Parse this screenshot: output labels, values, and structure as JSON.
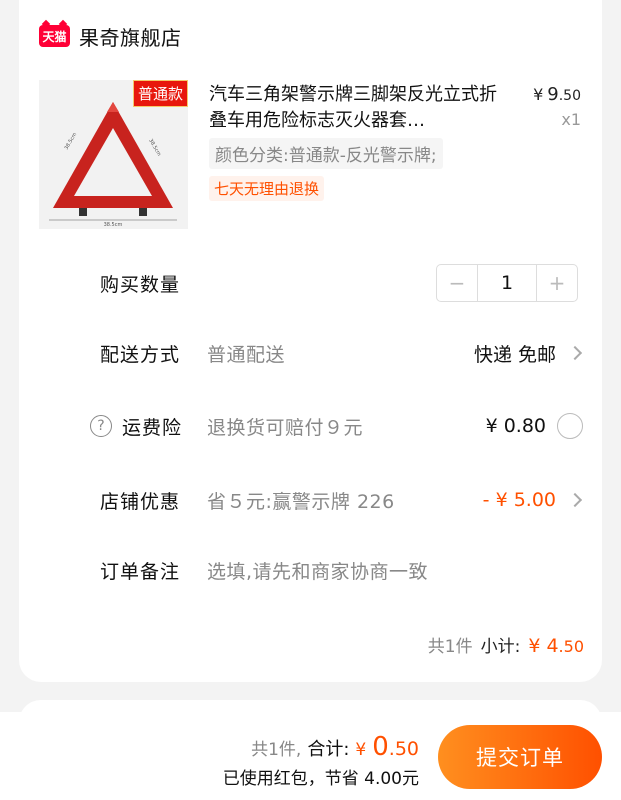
{
  "store": {
    "badge": "天猫",
    "name": "果奇旗舰店"
  },
  "product": {
    "image_tag": "普通款",
    "triangle_labels": [
      "38.5cm",
      "38.5cm",
      "38.5cm"
    ],
    "title": "汽车三角架警示牌三脚架反光立式折叠车用危险标志灭火器套…",
    "price_currency": "¥",
    "price_int": "9",
    "price_dec": ".50",
    "quantity_text": "x1",
    "variant": "颜色分类:普通款-反光警示牌;",
    "refund_tag": "七天无理由退换"
  },
  "quantity": {
    "label": "购买数量",
    "minus": "−",
    "value": "1",
    "plus": "+"
  },
  "delivery": {
    "label": "配送方式",
    "sub": "普通配送",
    "value": "快递 免邮"
  },
  "insurance": {
    "help": "?",
    "label": "运费险",
    "sub": "退换货可赔付９元",
    "value": "¥ 0.80"
  },
  "discount": {
    "label": "店铺优惠",
    "sub": "省５元:赢警示牌 226",
    "value": "- ¥ 5.00"
  },
  "note": {
    "label": "订单备注",
    "placeholder": "选填,请先和商家协商一致"
  },
  "subtotal": {
    "count": "共1件",
    "label": "小计:",
    "currency": "¥",
    "int": "4",
    "dec": ".50"
  },
  "footer": {
    "count": "共1件,",
    "total_label": "合计:",
    "currency": "¥",
    "int": "0",
    "dec": ".50",
    "saving": "已使用红包，节省 4.00元",
    "submit": "提交订单"
  },
  "colors": {
    "accent": "#ff5000",
    "tmall_red": "#ff0036",
    "muted": "#888888"
  }
}
